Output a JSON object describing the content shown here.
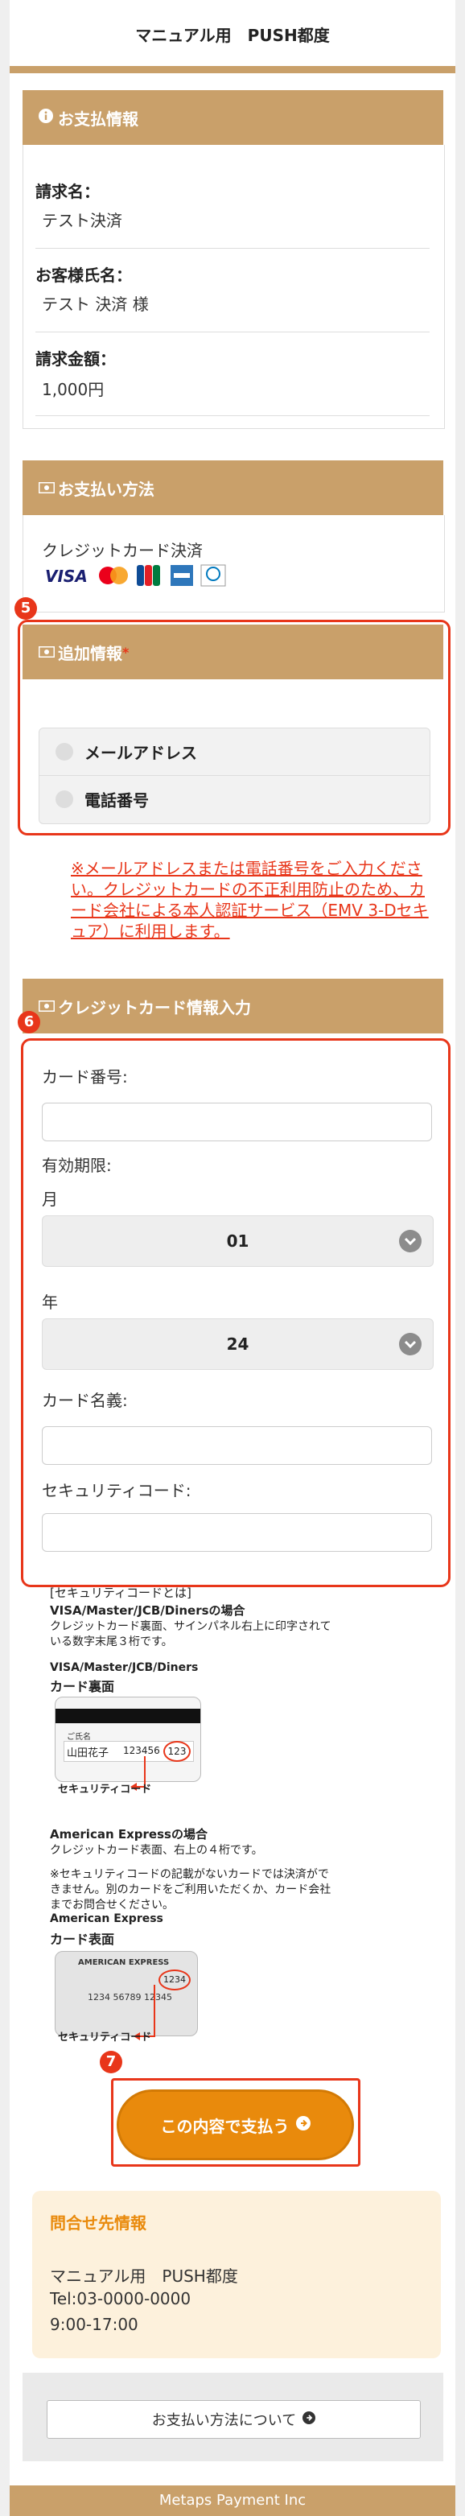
{
  "header": {
    "title": "マニュアル用　PUSH都度"
  },
  "payment_info": {
    "heading": "お支払情報",
    "fields": [
      {
        "label": "請求名：",
        "value": "テスト決済"
      },
      {
        "label": "お客様氏名：",
        "value": "テスト 決済 様"
      },
      {
        "label": "請求金額：",
        "value": "1,000円"
      }
    ]
  },
  "payment_method": {
    "heading": "お支払い方法",
    "method": "クレジットカード決済",
    "brands": [
      "VISA",
      "Mastercard",
      "JCB",
      "American Express",
      "Diners Club"
    ]
  },
  "additional_info": {
    "badge": "5",
    "heading": "追加情報",
    "required_mark": "*",
    "options": [
      "メールアドレス",
      "電話番号"
    ],
    "notice": "※メールアドレスまたは電話番号をご入力ください。クレジットカードの不正利用防止のため、カード会社による本人認証サービス（EMV 3-Dセキュア）に利用します。"
  },
  "card_input": {
    "badge": "6",
    "heading": "クレジットカード情報入力",
    "card_number_label": "カード番号:",
    "expiry_label": "有効期限:",
    "month_label": "月",
    "month_value": "01",
    "year_label": "年",
    "year_value": "24",
    "card_name_label": "カード名義:",
    "security_code_label": "セキュリティコード:"
  },
  "security_info": {
    "heading": "[セキュリティコードとは]",
    "vmjd_title": "VISA/Master/JCB/Dinersの場合",
    "vmjd_text": "クレジットカード裏面、サインパネル右上に印字されている数字末尾３桁です。",
    "vmjd_card_brand": "VISA/Master/JCB/Diners",
    "vmjd_card_side": "カード裏面",
    "vmjd_card_holder_label": "ご氏名",
    "vmjd_card_holder": "山田花子",
    "vmjd_card_number": "123456",
    "vmjd_code": "123",
    "vmjd_caption": "セキュリティコード",
    "amex_title": "American Expressの場合",
    "amex_text": "クレジットカード表面、右上の４桁です。",
    "amex_note": "※セキュリティコードの記載がないカードでは決済ができません。別のカードをご利用いただくか、カード会社までお問合せください。",
    "amex_card_brand": "American Express",
    "amex_card_side": "カード表面",
    "amex_card_label": "AMERICAN EXPRESS",
    "amex_card_number": "1234 56789 12345",
    "amex_code": "1234",
    "amex_caption": "セキュリティコード"
  },
  "pay_button": {
    "badge": "7",
    "label": "この内容で支払う"
  },
  "contact": {
    "heading": "問合せ先情報",
    "name": "マニュアル用　PUSH都度",
    "tel": "Tel:03-0000-0000",
    "hours": "9:00-17:00"
  },
  "about_button": {
    "label": "お支払い方法について"
  },
  "footer": {
    "text": "Metaps Payment Inc"
  },
  "colors": {
    "accent": "#c9a06a",
    "badge_red": "#e8361a",
    "button_orange": "#e98a0c"
  }
}
